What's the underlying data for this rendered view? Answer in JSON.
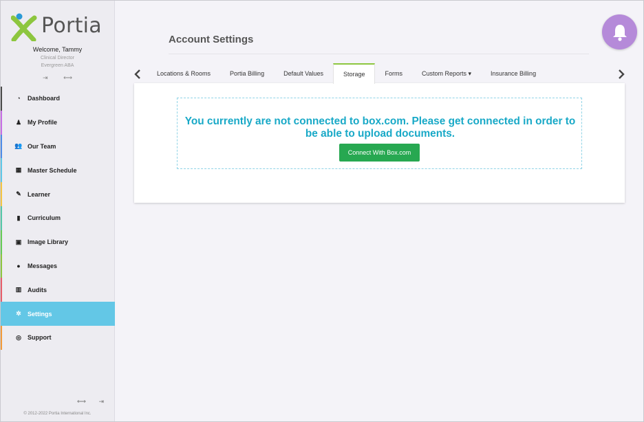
{
  "app": {
    "logo_text": "Portia",
    "welcome": "Welcome, Tammy",
    "role": "Clinical Director",
    "org": "Evergreen ABA",
    "copyright": "© 2012-2022 Portia International Inc."
  },
  "sidebar": {
    "items": [
      {
        "label": "Dashboard",
        "icon": "dashboard-icon",
        "color": "#4a4a4a"
      },
      {
        "label": "My Profile",
        "icon": "user-icon",
        "color": "#c86ee6"
      },
      {
        "label": "Our Team",
        "icon": "team-icon",
        "color": "#4d8be8"
      },
      {
        "label": "Master Schedule",
        "icon": "calendar-icon",
        "color": "#5fc8e8"
      },
      {
        "label": "Learner",
        "icon": "pencil-icon",
        "color": "#f4c542"
      },
      {
        "label": "Curriculum",
        "icon": "book-icon",
        "color": "#55c8a8"
      },
      {
        "label": "Image Library",
        "icon": "image-icon",
        "color": "#66cc55"
      },
      {
        "label": "Messages",
        "icon": "comment-icon",
        "color": "#8dc63f"
      },
      {
        "label": "Audits",
        "icon": "bar-chart-icon",
        "color": "#e85d6a"
      },
      {
        "label": "Settings",
        "icon": "gear-icon",
        "color": "#63c7e6"
      },
      {
        "label": "Support",
        "icon": "lifebuoy-icon",
        "color": "#f29a38"
      }
    ],
    "active_index": 9
  },
  "main": {
    "title": "Account Settings",
    "tabs": [
      {
        "label": "Locations & Rooms"
      },
      {
        "label": "Portia Billing"
      },
      {
        "label": "Default Values"
      },
      {
        "label": "Storage"
      },
      {
        "label": "Forms"
      },
      {
        "label": "Custom Reports ▾"
      },
      {
        "label": "Insurance Billing"
      }
    ],
    "active_tab": 3,
    "notice": "You currently are not connected to box.com. Please get connected in order to be able to upload documents.",
    "connect_button": "Connect With Box.com"
  },
  "colors": {
    "accent": "#63c7e6",
    "notice_text": "#19a9c7",
    "button_green": "#27a851",
    "bell": "#b58ad9"
  }
}
